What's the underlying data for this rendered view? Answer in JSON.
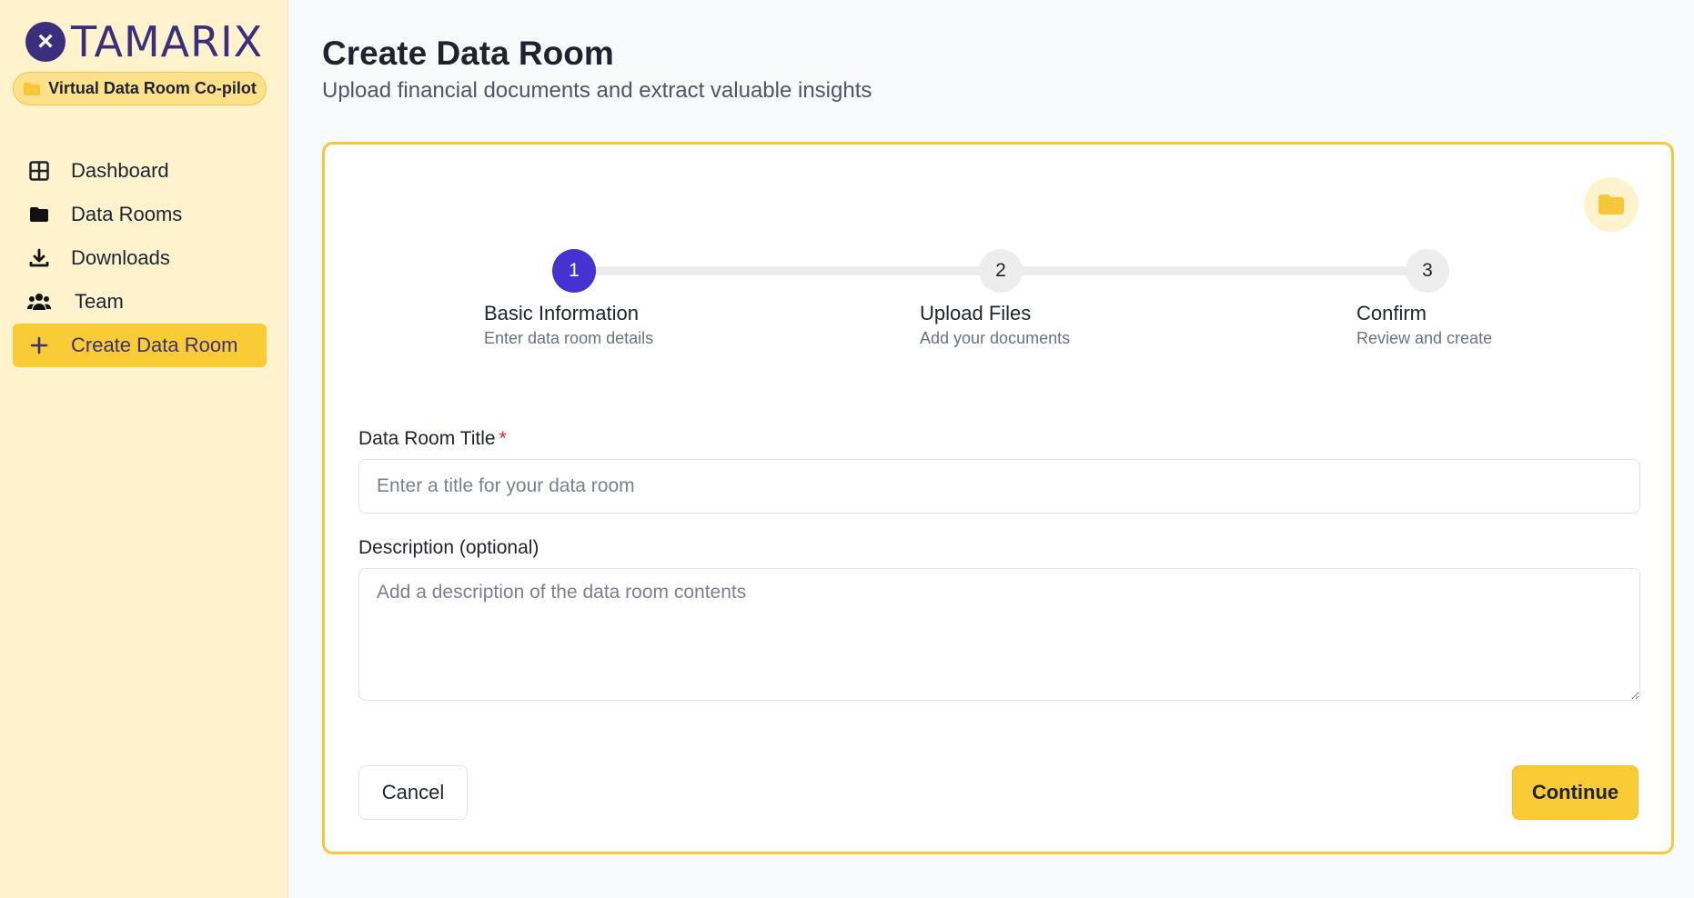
{
  "brand": {
    "logo_text": "TAMARIX",
    "badge_label": "Virtual Data Room Co-pilot",
    "accent_color": "#f9cc35",
    "primary_color": "#3b2f7d"
  },
  "sidebar": {
    "items": [
      {
        "label": "Dashboard",
        "icon": "grid-icon"
      },
      {
        "label": "Data Rooms",
        "icon": "folder-icon"
      },
      {
        "label": "Downloads",
        "icon": "download-icon"
      },
      {
        "label": "Team",
        "icon": "users-icon"
      },
      {
        "label": "Create Data Room",
        "icon": "plus-icon",
        "active": true
      }
    ]
  },
  "header": {
    "title": "Create Data Room",
    "subtitle": "Upload financial documents and extract valuable insights"
  },
  "stepper": {
    "steps": [
      {
        "number": "1",
        "label": "Basic Information",
        "desc": "Enter data room details",
        "active": true
      },
      {
        "number": "2",
        "label": "Upload Files",
        "desc": "Add your documents"
      },
      {
        "number": "3",
        "label": "Confirm",
        "desc": "Review and create"
      }
    ]
  },
  "form": {
    "title_label": "Data Room Title",
    "title_required": "*",
    "title_placeholder": "Enter a title for your data room",
    "title_value": "",
    "description_label": "Description (optional)",
    "description_placeholder": "Add a description of the data room contents",
    "description_value": ""
  },
  "actions": {
    "cancel_label": "Cancel",
    "continue_label": "Continue"
  }
}
